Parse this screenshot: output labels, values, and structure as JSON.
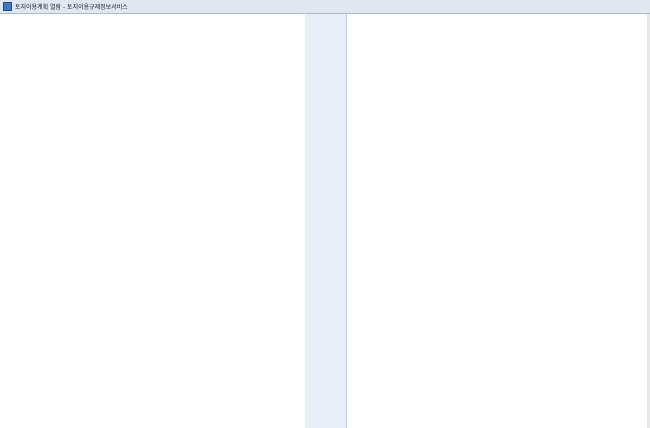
{
  "window": {
    "title": "토지이용계획 열람 - 토지이용규제정보서비스"
  },
  "sidebar": {
    "section_label": ""
  },
  "content": {
    "blocks": [
      {
        "text": ""
      },
      {
        "text": ""
      },
      {
        "text": ""
      },
      {
        "text": ""
      },
      {
        "text": ""
      },
      {
        "text": ""
      },
      {
        "text": ""
      },
      {
        "text": ""
      },
      {
        "text": ""
      },
      {
        "text": ""
      },
      {
        "text": ""
      },
      {
        "text": ""
      },
      {
        "text": ""
      },
      {
        "text": ""
      },
      {
        "text": ""
      },
      {
        "text": ""
      },
      {
        "text": ""
      },
      {
        "text": ""
      },
      {
        "text": ""
      },
      {
        "text": ""
      },
      {
        "text": ""
      },
      {
        "text": ""
      },
      {
        "text": ""
      },
      {
        "text": ""
      },
      {
        "text": ""
      },
      {
        "text": ""
      },
      {
        "text": ""
      },
      {
        "text": ""
      },
      {
        "text": ""
      },
      {
        "text": ""
      },
      {
        "text": ""
      },
      {
        "text": ""
      },
      {
        "text": ""
      },
      {
        "text": ""
      },
      {
        "text": ""
      }
    ]
  }
}
